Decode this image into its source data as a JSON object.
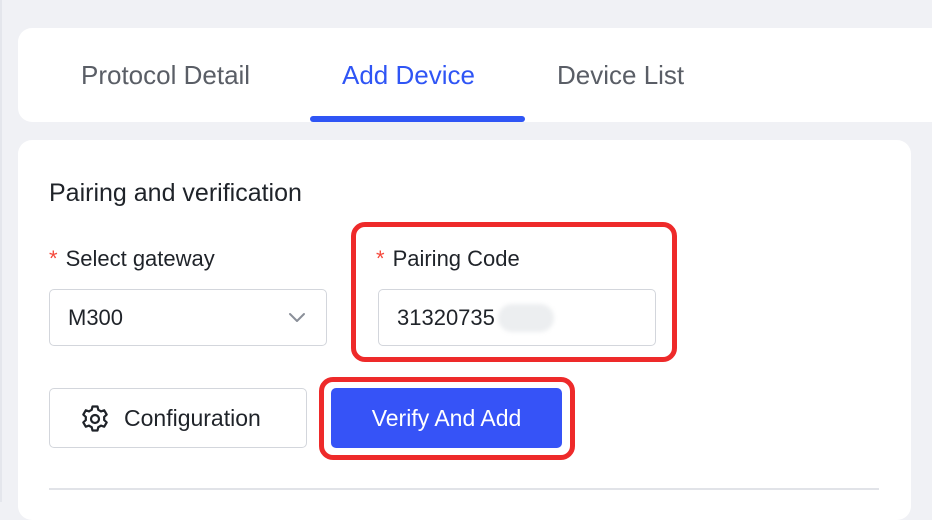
{
  "tabs": [
    {
      "label": "Protocol Detail",
      "active": false
    },
    {
      "label": "Add Device",
      "active": true
    },
    {
      "label": "Device List",
      "active": false
    }
  ],
  "form": {
    "section_title": "Pairing and verification",
    "required_mark": "*",
    "gateway": {
      "label": "Select gateway",
      "value": "M300"
    },
    "pairing_code": {
      "label": "Pairing Code",
      "value": "31320735"
    }
  },
  "buttons": {
    "configuration_label": "Configuration",
    "verify_label": "Verify And Add"
  },
  "colors": {
    "accent": "#2f55f5",
    "primary_button": "#3653f7",
    "highlight": "#ee2a2a",
    "required": "#f5483b"
  },
  "icons": {
    "select_chevron": "chevron-down-icon",
    "configuration": "gear-icon"
  }
}
